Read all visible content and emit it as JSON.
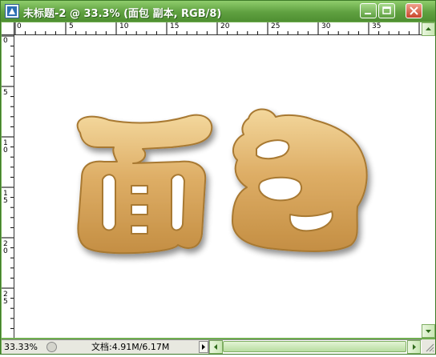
{
  "window": {
    "title": "未标题-2 @ 33.3% (面包 副本, RGB/8)"
  },
  "rulers": {
    "top": [
      "0",
      "5",
      "10",
      "15",
      "20",
      "25",
      "30",
      "35"
    ],
    "left": [
      "0",
      "5",
      "10",
      "15",
      "20",
      "25"
    ]
  },
  "artwork": {
    "text": "面包",
    "fill_color": "#d9a75c",
    "edge_color": "#a87932",
    "highlight_color": "#f3d79c"
  },
  "statusbar": {
    "zoom": "33.33%",
    "doc_info": "文档:4.91M/6.17M"
  },
  "icons": {
    "app": "photoshop-document-icon",
    "minimize": "minimize-icon",
    "maximize": "maximize-icon",
    "close": "close-icon",
    "scroll_up": "arrow-up-icon",
    "scroll_down": "arrow-down-icon",
    "scroll_left": "arrow-left-icon",
    "scroll_right": "arrow-right-icon"
  },
  "theme": {
    "frame": "#6fae4f",
    "titlebar": "#5fa040"
  }
}
